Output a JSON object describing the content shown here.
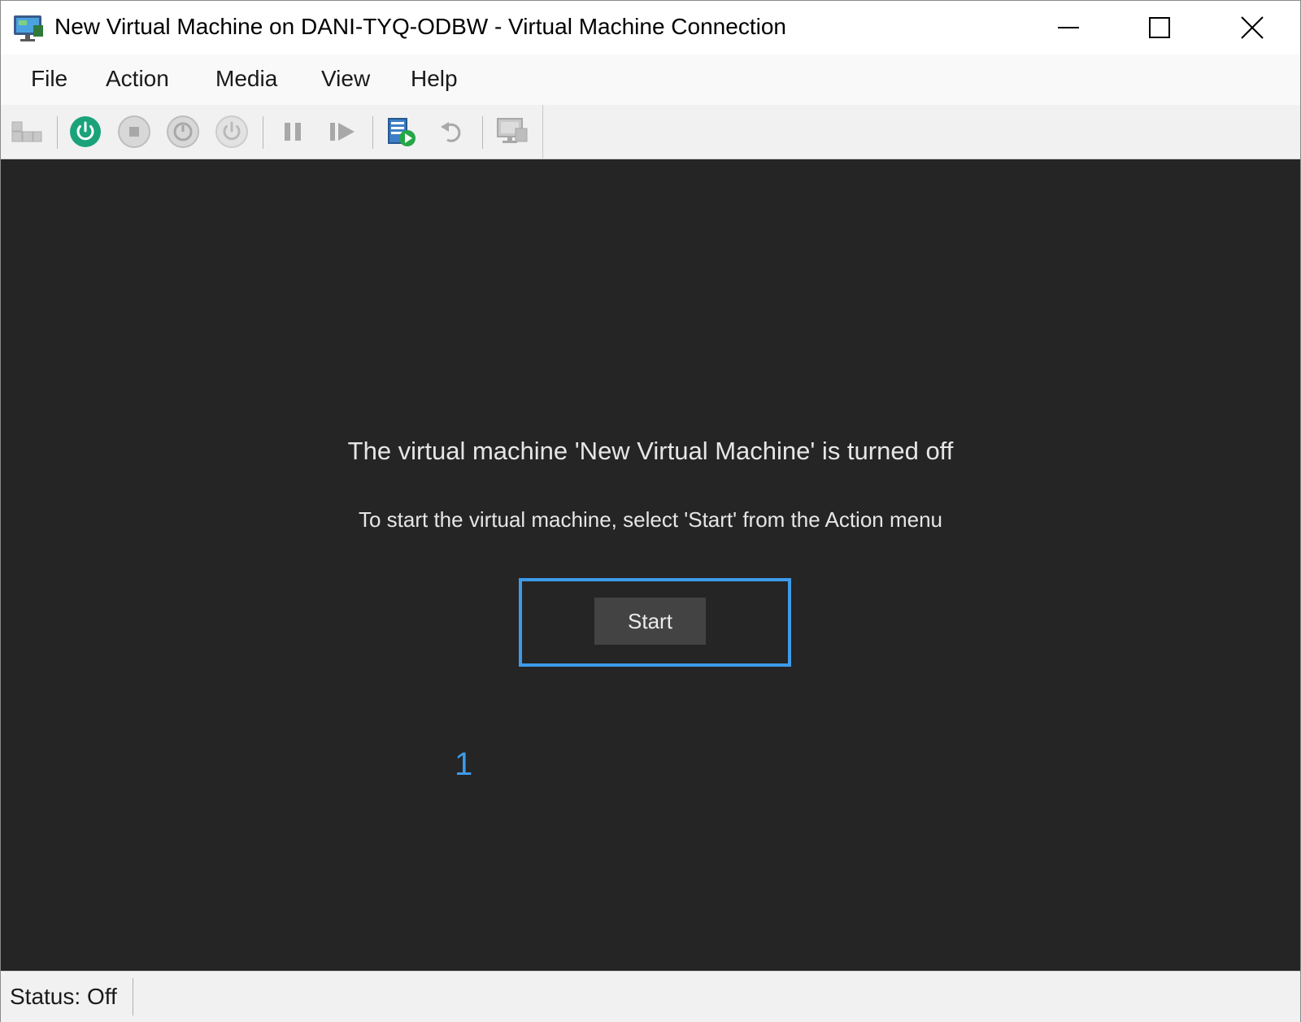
{
  "window": {
    "title": "New Virtual Machine on DANI-TYQ-ODBW - Virtual Machine Connection",
    "app_icon": "vm-connection-icon",
    "controls": {
      "minimize_icon": "minimize-icon",
      "maximize_icon": "maximize-icon",
      "close_icon": "close-icon"
    }
  },
  "menu": {
    "items": [
      {
        "label": "File"
      },
      {
        "label": "Action"
      },
      {
        "label": "Media"
      },
      {
        "label": "View"
      },
      {
        "label": "Help"
      }
    ]
  },
  "toolbar": {
    "buttons": [
      {
        "icon": "ctrl-alt-del-icon",
        "enabled": false
      },
      {
        "icon": "start-icon",
        "enabled": true,
        "color": "#1aa37a"
      },
      {
        "icon": "turn-off-icon",
        "enabled": false
      },
      {
        "icon": "shut-down-icon",
        "enabled": false
      },
      {
        "icon": "save-state-icon",
        "enabled": false
      },
      {
        "icon": "pause-icon",
        "enabled": false
      },
      {
        "icon": "resume-icon",
        "enabled": false
      },
      {
        "icon": "checkpoint-icon",
        "enabled": true
      },
      {
        "icon": "revert-icon",
        "enabled": false
      },
      {
        "icon": "enhanced-session-icon",
        "enabled": false
      }
    ]
  },
  "main": {
    "message_title": "The virtual machine 'New Virtual Machine' is turned off",
    "message_subtitle": "To start the virtual machine, select 'Start' from the Action menu",
    "start_button_label": "Start",
    "annotation_number": "1",
    "background_color": "#252525",
    "highlight_color": "#3d9be9"
  },
  "statusbar": {
    "status_text": "Status: Off"
  }
}
